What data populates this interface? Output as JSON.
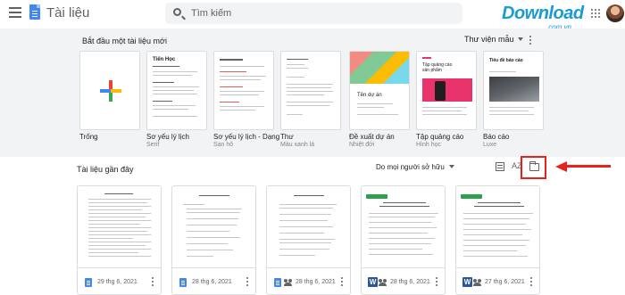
{
  "app": {
    "title": "Tài liệu"
  },
  "search": {
    "placeholder": "Tìm kiếm"
  },
  "watermark": {
    "brand": "Download",
    "domain": ".com.vn",
    "dots": [
      "#e94e3b",
      "#f5a623",
      "#7ac143",
      "#1a9ad6"
    ]
  },
  "templates": {
    "heading": "Bắt đầu một tài liệu mới",
    "gallery_label": "Thư viện mẫu",
    "items": [
      {
        "name": "Trống",
        "sub": ""
      },
      {
        "name": "Sơ yếu lý lịch",
        "sub": "Serif"
      },
      {
        "name": "Sơ yếu lý lịch - Dạng",
        "sub": "San hô"
      },
      {
        "name": "Thư",
        "sub": "Màu xanh lá"
      },
      {
        "name": "Đề xuất dự án",
        "sub": "Nhiệt đới"
      },
      {
        "name": "Tập quảng cáo",
        "sub": "Hình học"
      },
      {
        "name": "Báo cáo",
        "sub": "Luxe"
      }
    ],
    "thumb_text": {
      "resume": "Tiến Học",
      "proposal": "Tên dự án",
      "brochure": "Tập quảng cáo sản phẩm",
      "report": "Tiêu đề báo cáo"
    }
  },
  "recent": {
    "heading": "Tài liệu gần đây",
    "owner_filter": "Do mọi người sở hữu",
    "sort_icon_label": "AZ",
    "documents": [
      {
        "type": "gdoc",
        "shared": false,
        "date": "29 thg 6, 2021"
      },
      {
        "type": "gdoc",
        "shared": false,
        "date": "28 thg 6, 2021"
      },
      {
        "type": "gdoc",
        "shared": true,
        "date": "28 thg 6, 2021"
      },
      {
        "type": "word",
        "shared": true,
        "date": "28 thg 6, 2021"
      },
      {
        "type": "word",
        "shared": true,
        "date": "27 thg 6, 2021"
      }
    ]
  },
  "colors": {
    "accent": "#4285f4",
    "highlight": "#e8221b",
    "template_bg": "#f1f3f4"
  },
  "icons": {
    "word": "W"
  }
}
